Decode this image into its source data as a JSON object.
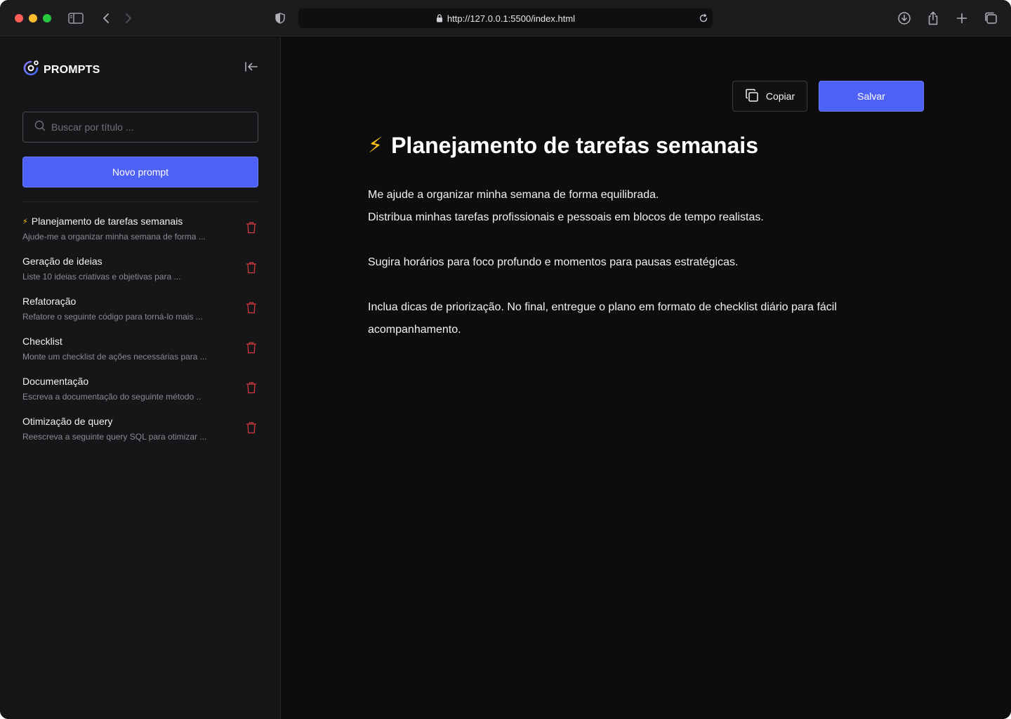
{
  "browser": {
    "url": "http://127.0.0.1:5500/index.html"
  },
  "sidebar": {
    "logo_text": "PROMPTS",
    "search_placeholder": "Buscar por título ...",
    "new_button_label": "Novo prompt",
    "items": [
      {
        "icon": "⚡",
        "title": "Planejamento de tarefas semanais",
        "desc": "Ajude-me a organizar minha semana de forma ..."
      },
      {
        "icon": "",
        "title": "Geração de ideias",
        "desc": "Liste 10 ideias criativas e objetivas para ..."
      },
      {
        "icon": "",
        "title": "Refatoração",
        "desc": "Refatore o seguinte código para torná-lo mais ..."
      },
      {
        "icon": "",
        "title": "Checklist",
        "desc": "Monte um checklist de ações necessárias para ..."
      },
      {
        "icon": "",
        "title": "Documentação",
        "desc": "Escreva a documentação do seguinte método .."
      },
      {
        "icon": "",
        "title": "Otimização de query",
        "desc": "Reescreva a seguinte query SQL para otimizar ..."
      }
    ]
  },
  "main": {
    "copy_label": "Copiar",
    "save_label": "Salvar",
    "title_emoji": "⚡",
    "title": "Planejamento de tarefas semanais",
    "body": [
      "Me ajude a organizar minha semana de forma equilibrada.",
      "Distribua minhas tarefas profissionais e pessoais em blocos de tempo realistas.",
      "",
      "Sugira horários para foco profundo e momentos para pausas estratégicas.",
      "",
      "Inclua dicas de priorização. No final, entregue o plano em formato de checklist diário para fácil acompanhamento."
    ]
  },
  "colors": {
    "accent": "#4e61f6",
    "danger": "#e5484d",
    "bolt": "#ffc21a"
  }
}
